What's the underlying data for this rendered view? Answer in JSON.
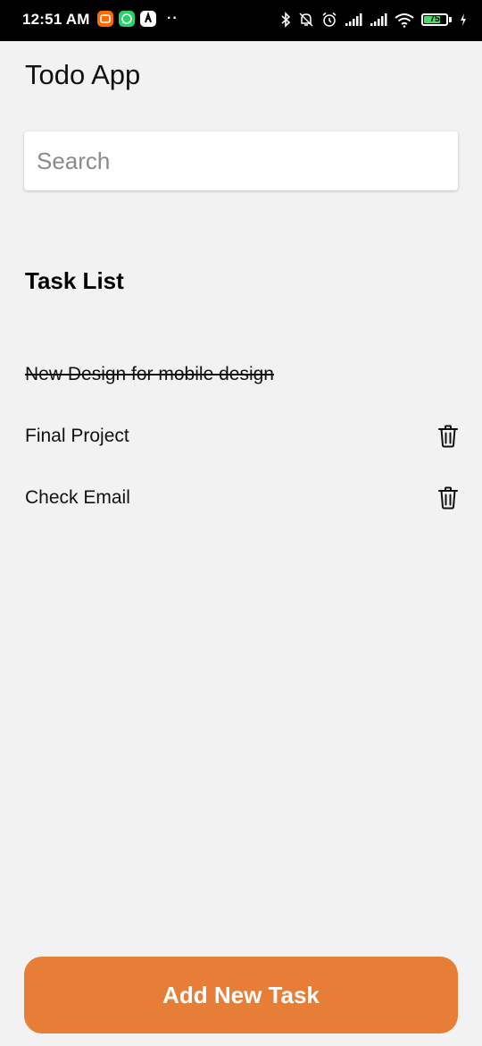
{
  "status_bar": {
    "time": "12:51 AM",
    "battery_level": "75",
    "battery_fraction": 0.75,
    "icons": [
      "mi-app-icon",
      "whatsapp-icon",
      "app-icon",
      "bluetooth-icon",
      "muted-bell-icon",
      "alarm-icon",
      "signal-icon",
      "signal-icon",
      "wifi-icon",
      "battery-icon",
      "charging-icon"
    ],
    "colors": {
      "mi_app": "#ff6a00",
      "whatsapp": "#25d366",
      "battery_fill": "#4cd964"
    }
  },
  "app": {
    "title": "Todo App"
  },
  "search": {
    "placeholder": "Search",
    "value": ""
  },
  "task_section": {
    "title": "Task List"
  },
  "tasks": [
    {
      "label": "New Design for mobile design",
      "done": true
    },
    {
      "label": "Final Project",
      "done": false
    },
    {
      "label": "Check Email",
      "done": false
    }
  ],
  "actions": {
    "add_label": "Add New Task"
  },
  "colors": {
    "background": "#f2f2f2",
    "accent": "#e67e37"
  }
}
